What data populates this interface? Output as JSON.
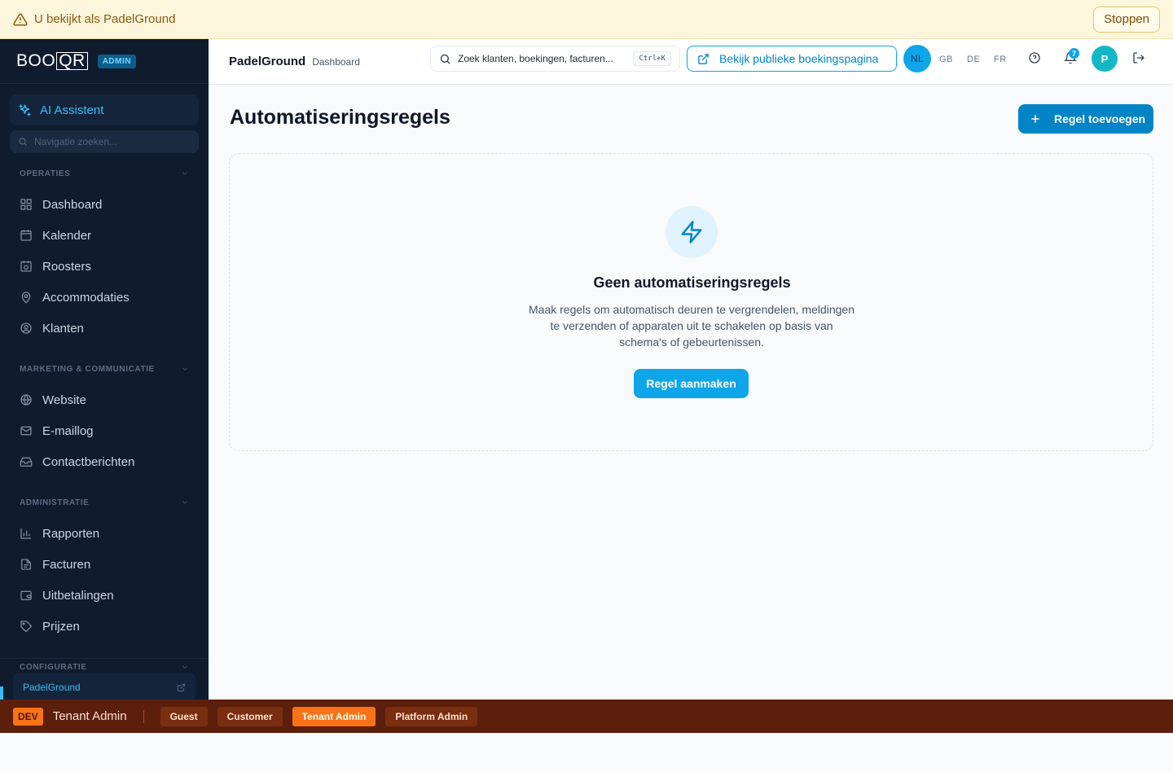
{
  "impersonation": {
    "text": "U bekijkt als PadelGround",
    "stop_label": "Stoppen"
  },
  "sidebar": {
    "logo_text": "BOOQR",
    "logo_main": "BOO",
    "logo_box": "QR",
    "admin_badge": "ADMIN",
    "ai_assistant": "AI Assistent",
    "nav_search_placeholder": "Navigatie zoeken...",
    "sections": [
      {
        "label": "OPERATIES",
        "items": [
          "Dashboard",
          "Kalender",
          "Roosters",
          "Accommodaties",
          "Klanten"
        ]
      },
      {
        "label": "MARKETING & COMMUNICATIE",
        "items": [
          "Website",
          "E-maillog",
          "Contactberichten"
        ]
      },
      {
        "label": "ADMINISTRATIE",
        "items": [
          "Rapporten",
          "Facturen",
          "Uitbetalingen",
          "Prijzen"
        ]
      },
      {
        "label": "CONFIGURATIE",
        "items": []
      }
    ],
    "tenant": "PadelGround"
  },
  "topbar": {
    "tenant_name": "PadelGround",
    "breadcrumb": "Dashboard",
    "search_placeholder": "Zoek klanten, boekingen, facturen...",
    "search_shortcut": "Ctrl+K",
    "public_link": "Bekijk publieke boekingspagina",
    "languages": [
      "NL",
      "GB",
      "DE",
      "FR"
    ],
    "active_language": "NL",
    "notification_count": "7",
    "avatar_initial": "P"
  },
  "main": {
    "title": "Automatiseringsregels",
    "add_button": "Regel toevoegen",
    "empty_title": "Geen automatiseringsregels",
    "empty_description": "Maak regels om automatisch deuren te vergrendelen, meldingen te verzenden of apparaten uit te schakelen op basis van schema's of gebeurtenissen.",
    "create_button": "Regel aanmaken"
  },
  "devbar": {
    "tag": "DEV",
    "current_role": "Tenant Admin",
    "roles": [
      "Guest",
      "Customer",
      "Tenant Admin",
      "Platform Admin"
    ],
    "active_role": "Tenant Admin"
  },
  "colors": {
    "accent": "#0ea5e9",
    "sidebar_bg": "#0f1c2e",
    "devbar_bg": "#5b1f0c",
    "warning_bg": "#fdf6dd"
  }
}
